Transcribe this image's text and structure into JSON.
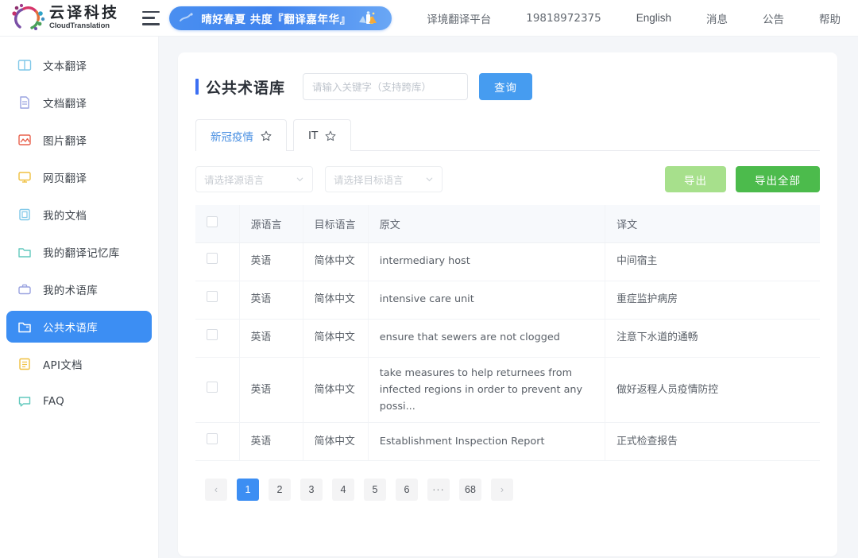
{
  "brand": {
    "name_cn": "云译科技",
    "name_en": "CloudTranslation",
    "logo_colors": [
      "#8e2f6e",
      "#d6356a",
      "#e2703a",
      "#2fa3c7",
      "#4aa05a",
      "#6b4fa8"
    ]
  },
  "topbar": {
    "menu_icon": "hamburger-icon",
    "promo": {
      "text": "晴好春夏 共度『翻译嘉年华』",
      "color": "#3f83ee"
    },
    "nav": [
      {
        "label": "译境翻译平台",
        "name": "platform"
      },
      {
        "label": "19818972375",
        "name": "account"
      },
      {
        "label": "English",
        "name": "language"
      },
      {
        "label": "消息",
        "name": "messages"
      },
      {
        "label": "公告",
        "name": "announcements"
      },
      {
        "label": "帮助",
        "name": "help"
      }
    ]
  },
  "sidebar": {
    "active_index": 7,
    "active_color": "#3c8ef3",
    "items": [
      {
        "label": "文本翻译",
        "icon": "book-icon",
        "color": "#7fc7e8"
      },
      {
        "label": "文档翻译",
        "icon": "document-icon",
        "color": "#9aa3e0"
      },
      {
        "label": "图片翻译",
        "icon": "image-icon",
        "color": "#e8604c"
      },
      {
        "label": "网页翻译",
        "icon": "monitor-icon",
        "color": "#f0c040"
      },
      {
        "label": "我的文档",
        "icon": "doc-folder-icon",
        "color": "#7fc7e8"
      },
      {
        "label": "我的翻译记忆库",
        "icon": "folder-icon",
        "color": "#62c9bd"
      },
      {
        "label": "我的术语库",
        "icon": "briefcase-icon",
        "color": "#9aa3e0"
      },
      {
        "label": "公共术语库",
        "icon": "open-folder-icon",
        "color": "#ffffff"
      },
      {
        "label": "API文档",
        "icon": "api-doc-icon",
        "color": "#f0c040"
      },
      {
        "label": "FAQ",
        "icon": "chat-icon",
        "color": "#62c9bd"
      }
    ]
  },
  "page": {
    "title": "公共术语库",
    "search": {
      "placeholder": "请输入关键字（支持跨库）",
      "value": "",
      "button_label": "查询",
      "button_color": "#469cf0"
    },
    "tabs": [
      {
        "label": "新冠疫情",
        "starred": false,
        "active": true
      },
      {
        "label": "IT",
        "starred": false,
        "active": false
      }
    ],
    "filters": {
      "source_language_placeholder": "请选择源语言",
      "target_language_placeholder": "请选择目标语言"
    },
    "actions": {
      "export_label": "导出",
      "export_all_label": "导出全部",
      "export_color": "#a7e08c",
      "export_all_color": "#4cbb4c"
    },
    "table": {
      "columns": [
        "",
        "源语言",
        "目标语言",
        "原文",
        "译文"
      ],
      "rows": [
        {
          "source_language": "英语",
          "target_language": "简体中文",
          "original": "intermediary host",
          "translation": "中间宿主"
        },
        {
          "source_language": "英语",
          "target_language": "简体中文",
          "original": "intensive care unit",
          "translation": "重症监护病房"
        },
        {
          "source_language": "英语",
          "target_language": "简体中文",
          "original": "ensure that sewers are not clogged",
          "translation": "注意下水道的通畅"
        },
        {
          "source_language": "英语",
          "target_language": "简体中文",
          "original": "take measures to help returnees from infected regions in order to prevent any possi...",
          "translation": "做好返程人员疫情防控"
        },
        {
          "source_language": "英语",
          "target_language": "简体中文",
          "original": "Establishment Inspection Report",
          "translation": "正式检查报告"
        }
      ]
    },
    "pagination": {
      "prev": "‹",
      "next": "›",
      "pages": [
        "1",
        "2",
        "3",
        "4",
        "5",
        "6",
        "···",
        "68"
      ],
      "current": "1",
      "active_color": "#3c8ef3"
    }
  }
}
